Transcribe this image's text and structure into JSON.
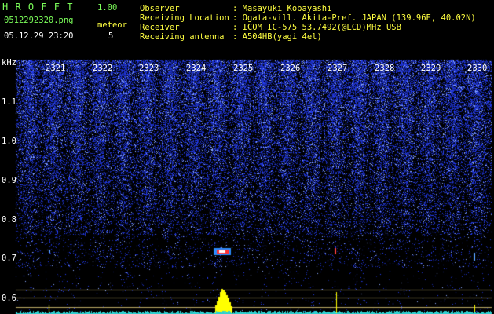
{
  "header": {
    "app_title": "H R O F F T",
    "version": "1.00",
    "filename": "0512292320.png",
    "meteor_label": "meteor",
    "datetime": "05.12.29 23:20",
    "meteor_count": "5",
    "fields": [
      {
        "label": "Observer",
        "value": ": Masayuki Kobayashi"
      },
      {
        "label": "Receiving Location",
        "value": ": Ogata-vill. Akita-Pref. JAPAN (139.96E, 40.02N)"
      },
      {
        "label": "Receiver",
        "value": ": ICOM IC-575 53.7492(@LCD)MHz USB"
      },
      {
        "label": "Receiving antenna",
        "value": ": A504HB(yagi 4el)"
      }
    ]
  },
  "plot": {
    "unit": "kHz",
    "time_ticks": [
      "2321",
      "2322",
      "2323",
      "2324",
      "2325",
      "2326",
      "2327",
      "2328",
      "2329",
      "2330"
    ],
    "freq_ticks": [
      "1.1",
      "1.0",
      "0.9",
      "0.8",
      "0.7",
      "0.6"
    ],
    "colors": {
      "text_green": "#7cff5a",
      "text_white": "#ffffff",
      "text_yellow": "#ffff40",
      "noise": "#2a3cff",
      "echo": "#ff3030",
      "bars": "#ffff00"
    }
  }
}
